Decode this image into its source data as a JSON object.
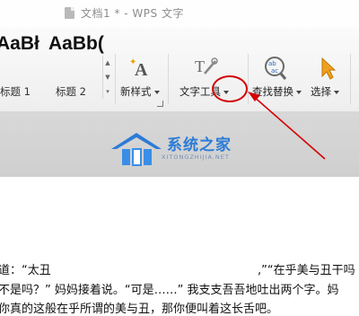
{
  "window": {
    "title": "文档1 * - WPS 文字"
  },
  "ribbon": {
    "styles": [
      {
        "sample": "AaBł",
        "label": "标题 1"
      },
      {
        "sample": "AaBb(",
        "label": "标题 2"
      }
    ],
    "new_style_label": "新样式",
    "text_tools_label": "文字工具",
    "find_replace_label": "查找替换",
    "select_label": "选择"
  },
  "watermark": {
    "name": "系统之家",
    "url": "XITONGZHIJIA.NET"
  },
  "document": {
    "lines": [
      "道：“太丑",
      ",”“在乎美与丑干吗",
      "不是吗？” 妈妈接着说。“可是……” 我支支吾吾地吐出两个字。妈",
      "你真的这般在乎所谓的美与丑，那你便叫着这长舌吧。"
    ]
  },
  "colors": {
    "annotation": "#d40000",
    "watermark_blue": "#2c7bd6",
    "ribbon_bg": "#f4f4f4"
  }
}
